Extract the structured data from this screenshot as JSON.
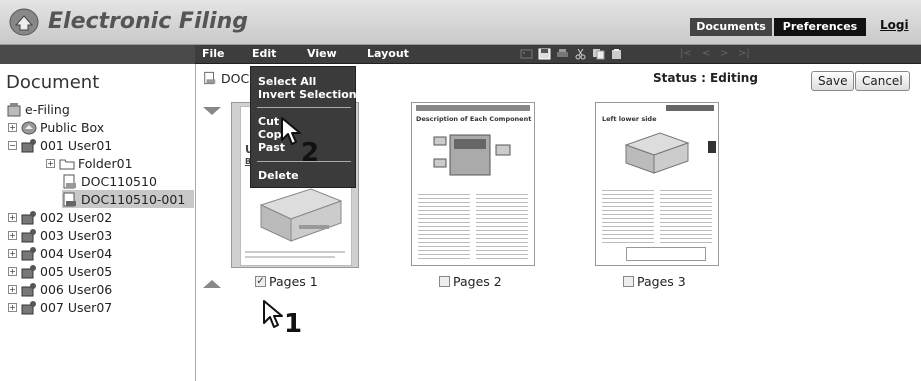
{
  "header": {
    "title": "Electronic Filing",
    "tabs": [
      {
        "label": "Documents"
      },
      {
        "label": "Preferences"
      }
    ],
    "login_label": "Logi"
  },
  "menubar": {
    "items": [
      "File",
      "Edit",
      "View",
      "Layout"
    ],
    "toolbar_icons": [
      "image-icon",
      "save-icon",
      "print-icon",
      "cut-icon",
      "copy-icon",
      "paste-icon"
    ],
    "nav_arrows": [
      "|<",
      "<",
      ">",
      ">|"
    ]
  },
  "sidebar": {
    "title": "Document",
    "tree": [
      {
        "label": "e-Filing",
        "icon": "efiling-icon"
      },
      {
        "label": "Public Box",
        "icon": "public-box-icon",
        "expander": "+"
      },
      {
        "label": "001 User01",
        "icon": "user-box-icon",
        "expander": "−"
      },
      {
        "label": "Folder01",
        "icon": "folder-icon",
        "expander": "+"
      },
      {
        "label": "DOC110510",
        "icon": "document-icon"
      },
      {
        "label": "DOC110510-001",
        "icon": "document-icon"
      },
      {
        "label": "002 User02",
        "icon": "user-box-icon",
        "expander": "+"
      },
      {
        "label": "003 User03",
        "icon": "user-box-icon",
        "expander": "+"
      },
      {
        "label": "004 User04",
        "icon": "user-box-icon",
        "expander": "+"
      },
      {
        "label": "005 User05",
        "icon": "user-box-icon",
        "expander": "+"
      },
      {
        "label": "006 User06",
        "icon": "user-box-icon",
        "expander": "+"
      },
      {
        "label": "007 User07",
        "icon": "user-box-icon",
        "expander": "+"
      }
    ]
  },
  "document": {
    "title": "DOC1",
    "status": "Status : Editing",
    "save_label": "Save",
    "cancel_label": "Cancel",
    "pages": [
      {
        "label": "Pages 1",
        "checked": true,
        "page_title": "Us",
        "page_subtitle": "Bas"
      },
      {
        "label": "Pages 2",
        "checked": false,
        "page_title": "Description of Each Component"
      },
      {
        "label": "Pages 3",
        "checked": false,
        "page_title": "Left lower side"
      }
    ]
  },
  "context_menu": {
    "items": [
      "Select All",
      "Invert Selection",
      "Cut",
      "Copy",
      "Paste",
      "Delete"
    ],
    "visible_items": [
      "Select All",
      "Invert Selection",
      "Cut",
      "Cop",
      "Past",
      "Delete"
    ]
  },
  "steps": [
    "1",
    "2"
  ],
  "colors": {
    "menubar": "#3d3d3d",
    "header_bg": "#d4d4d4",
    "selected_row": "#c8c8c8",
    "tab_active": "#111111"
  }
}
